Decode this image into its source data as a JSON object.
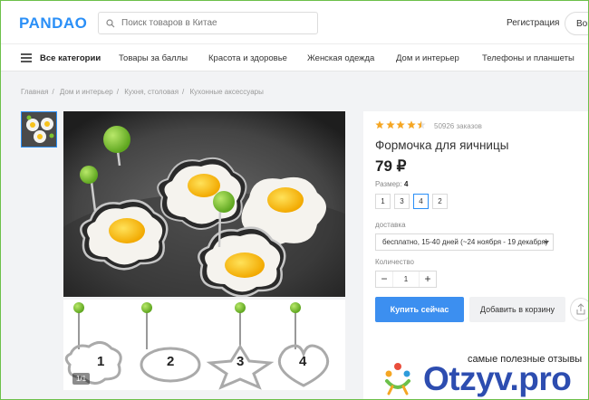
{
  "header": {
    "logo_text": "PANDAO",
    "search_placeholder": "Поиск товаров в Китае",
    "register_label": "Регистрация",
    "login_label": "Вой"
  },
  "nav": {
    "items": [
      "Все категории",
      "Товары за баллы",
      "Красота и здоровье",
      "Женская одежда",
      "Дом и интерьер",
      "Телефоны и планшеты"
    ]
  },
  "breadcrumbs": [
    "Главная",
    "Дом и интерьер",
    "Кухня, столовая",
    "Кухонные аксессуары"
  ],
  "gallery": {
    "counter": "1/1",
    "strip_numbers": [
      "1",
      "2",
      "3",
      "4"
    ]
  },
  "product": {
    "rating": 4.5,
    "orders": "50926 заказов",
    "title": "Формочка для яичницы",
    "price": "79 ₽",
    "size_label": "Размер:",
    "size_selected": "4",
    "sizes": [
      "1",
      "3",
      "4",
      "2"
    ],
    "shipping_label": "доставка",
    "shipping_value": "бесплатно, 15-40 дней (~24 ноября - 19 декабря)",
    "quantity_label": "Количество",
    "quantity_value": "1",
    "buy_label": "Купить сейчас",
    "cart_label": "Добавить в корзину"
  },
  "watermark": {
    "slogan": "самые полезные отзывы",
    "brand": "Otzyv.pro"
  },
  "colors": {
    "accent": "#3c8ff0",
    "star": "#f5a623",
    "watermark": "#2d4db0"
  }
}
